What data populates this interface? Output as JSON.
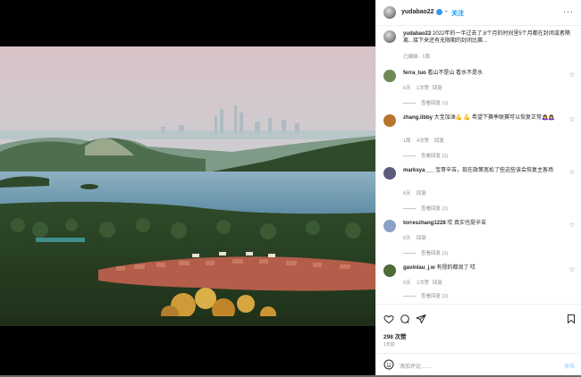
{
  "post": {
    "author": "yudabao22",
    "follow_label": "关注",
    "more_glyph": "···",
    "caption": "2022年的一半过去了,6个月的时间里5个月都在封闭或者隔离...接下来还有无限期的封闭比赛...",
    "edited": "已编辑 · 1周",
    "likes": "298 次赞",
    "time": "1天前"
  },
  "comments": [
    {
      "user": "ferra_luo",
      "text": "看山不是山 看水不是水",
      "age": "6天",
      "likes": "1次赞",
      "reply": "回复",
      "view_replies": "查看回复 (1)",
      "avatar_color": "#6f8a58"
    },
    {
      "user": "zhang.libby",
      "text": "大宝加油💪 💪 希望下赛季联赛可以恢复正常🙇‍♀️🙇‍♀️",
      "age": "1周",
      "likes": "4次赞",
      "reply": "回复",
      "view_replies": "查看回复 (1)",
      "avatar_color": "#b8742e"
    },
    {
      "user": "marksya___",
      "text": "宝哥辛苦，现在政策宽松了些这些该会恢复主客场",
      "age": "6天",
      "likes": "",
      "reply": "回复",
      "view_replies": "查看回复 (1)",
      "avatar_color": "#5b5b7a"
    },
    {
      "user": "torreszhang1228",
      "text": "哎 真实也挺辛苦",
      "age": "6天",
      "likes": "",
      "reply": "回复",
      "view_replies": "查看回复 (1)",
      "avatar_color": "#8aa0c8"
    },
    {
      "user": "gavinlau_j.w",
      "text": "有授的都润了 哎",
      "age": "6天",
      "likes": "1次赞",
      "reply": "回复",
      "view_replies": "查看回复 (1)",
      "avatar_color": "#4e6b3a"
    }
  ],
  "add_comment": {
    "placeholder": "添加评论……",
    "post_label": "发布"
  },
  "icons": {
    "like": "heart-icon",
    "comment": "comment-icon",
    "share": "share-icon",
    "save": "bookmark-icon",
    "emoji": "emoji-icon"
  }
}
